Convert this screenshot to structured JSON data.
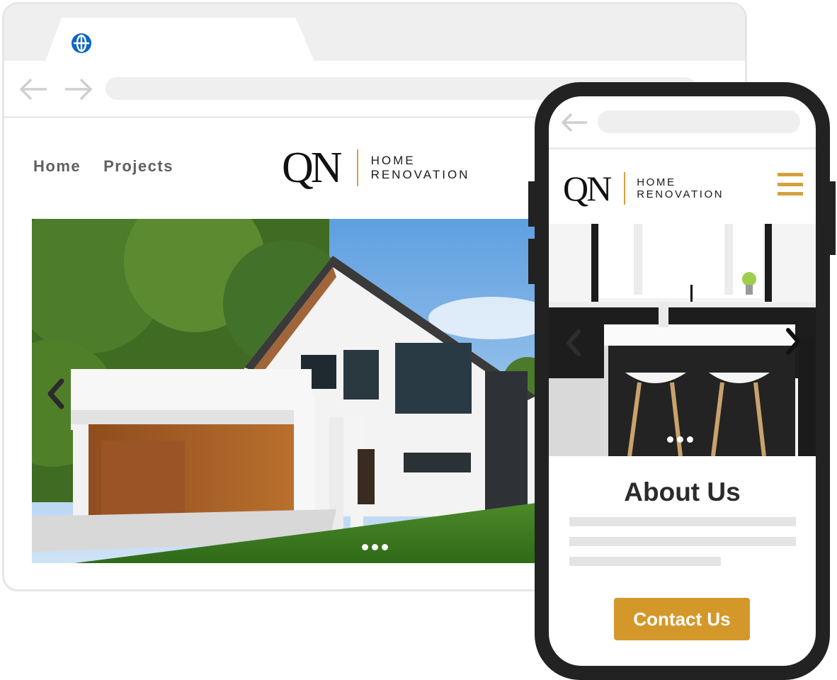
{
  "desktop": {
    "browser": {
      "tab_icon": "globe-icon",
      "back_icon": "arrow-left-icon",
      "forward_icon": "arrow-right-icon",
      "url_value": ""
    },
    "nav": {
      "items": [
        {
          "label": "Home"
        },
        {
          "label": "Projects"
        }
      ]
    },
    "logo": {
      "mark": "QN",
      "line1": "HOME",
      "line2": "RENOVATION"
    },
    "hero": {
      "image": "modern white house with wooden garage and lawn",
      "prev_icon": "chevron-left-icon",
      "dots": 3
    }
  },
  "mobile": {
    "browser": {
      "back_icon": "arrow-left-icon",
      "url_value": ""
    },
    "logo": {
      "mark": "QN",
      "line1": "HOME",
      "line2": "RENOVATION"
    },
    "menu_icon": "hamburger-menu-icon",
    "hero": {
      "image": "modern black and white kitchen with bar stools",
      "prev_icon": "chevron-left-icon",
      "next_icon": "chevron-right-icon",
      "dots": 3
    },
    "about": {
      "heading": "About Us"
    },
    "cta": {
      "label": "Contact Us"
    }
  },
  "colors": {
    "accent": "#d4982a",
    "logo_divider": "#d4a13f",
    "globe": "#0a66c2",
    "phone_frame": "#222222",
    "placeholder_line": "#e4e4e4"
  }
}
